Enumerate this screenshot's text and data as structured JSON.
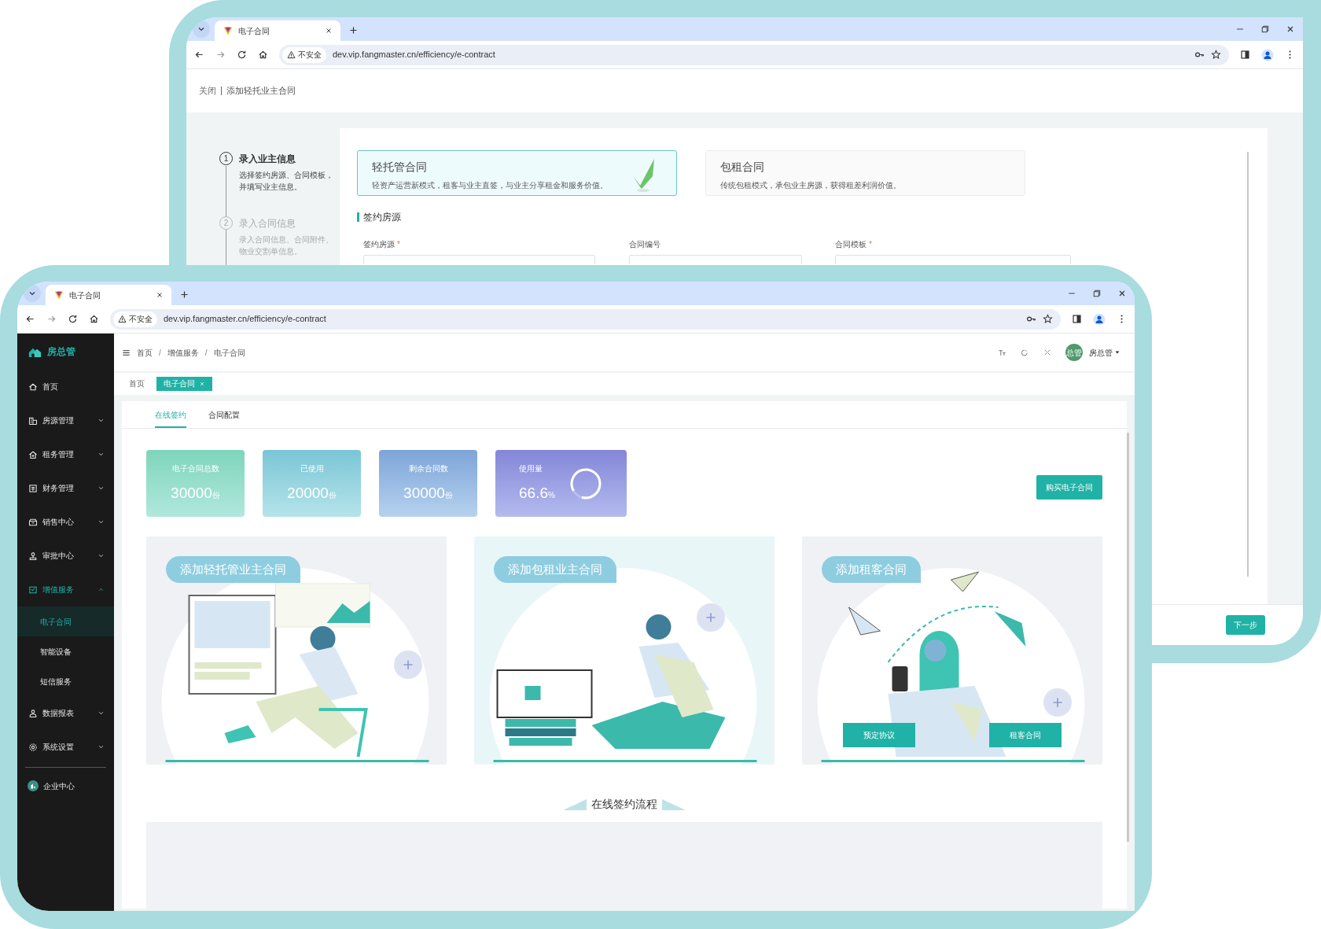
{
  "back_window": {
    "browser": {
      "tab_title": "电子合同",
      "security_label": "不安全",
      "url": "dev.vip.fangmaster.cn/efficiency/e-contract"
    },
    "page_header": {
      "close_link": "关闭",
      "title": "添加轻托业主合同"
    },
    "steps": [
      {
        "number": "1",
        "title": "录入业主信息",
        "description": "选择签约房源、合同模板，并填写业主信息。",
        "active": true
      },
      {
        "number": "2",
        "title": "录入合同信息",
        "description": "录入合同信息、合同附件、物业交割单信息。",
        "active": false
      }
    ],
    "contract_types": [
      {
        "title": "轻托管合同",
        "description": "轻资产运营新模式，租客与业主直签，与业主分享租金和服务价值。",
        "selected": true
      },
      {
        "title": "包租合同",
        "description": "传统包租模式，承包业主房源，获得租差利润价值。",
        "selected": false
      }
    ],
    "section_title": "签约房源",
    "fields": [
      {
        "label": "签约房源",
        "required_mark": "*"
      },
      {
        "label": "合同编号"
      },
      {
        "label": "合同模板",
        "required_mark": "*"
      }
    ],
    "next_button": "下一步"
  },
  "front_window": {
    "browser": {
      "tab_title": "电子合同",
      "security_label": "不安全",
      "url": "dev.vip.fangmaster.cn/efficiency/e-contract"
    },
    "sidebar": {
      "brand": "房总管",
      "items": [
        {
          "label": "首页"
        },
        {
          "label": "房源管理",
          "expanded": false
        },
        {
          "label": "租务管理",
          "expanded": false
        },
        {
          "label": "财务管理",
          "expanded": false
        },
        {
          "label": "销售中心",
          "expanded": false
        },
        {
          "label": "审批中心",
          "expanded": false
        },
        {
          "label": "增值服务",
          "expanded": true,
          "children": [
            {
              "label": "电子合同",
              "selected": true
            },
            {
              "label": "智能设备",
              "selected": false
            },
            {
              "label": "短信服务",
              "selected": false
            }
          ]
        },
        {
          "label": "数据报表",
          "expanded": false
        },
        {
          "label": "系统设置",
          "expanded": false
        }
      ],
      "footer_item": "企业中心"
    },
    "breadcrumb": [
      {
        "kind": "link",
        "text": "首页"
      },
      {
        "kind": "separator",
        "text": "/"
      },
      {
        "kind": "link",
        "text": "增值服务"
      },
      {
        "kind": "separator",
        "text": "/"
      },
      {
        "kind": "current",
        "text": "电子合同"
      }
    ],
    "user": {
      "avatar": "总管",
      "name": "房总管"
    },
    "page_tabs": [
      {
        "label": "首页",
        "selected": false
      },
      {
        "label": "电子合同",
        "selected": true
      }
    ],
    "content_tabs": [
      {
        "label": "在线签约",
        "selected": true
      },
      {
        "label": "合同配置",
        "selected": false
      }
    ],
    "stats": [
      {
        "kind": "count",
        "label": "电子合同总数",
        "value": "30000",
        "unit": "份"
      },
      {
        "kind": "count",
        "label": "已使用",
        "value": "20000",
        "unit": "份"
      },
      {
        "kind": "count",
        "label": "剩余合同数",
        "value": "30000",
        "unit": "份"
      },
      {
        "kind": "ring",
        "label": "使用量",
        "value": "66.6",
        "unit": "%",
        "level": 0.88
      }
    ],
    "buy_button": "购买电子合同",
    "contract_cards": [
      {
        "label": "添加轻托管业主合同"
      },
      {
        "label": "添加包租业主合同"
      },
      {
        "label": "添加租客合同",
        "buttons": [
          "预定协议",
          "租客合同"
        ]
      }
    ],
    "process_title": "在线签约流程"
  }
}
